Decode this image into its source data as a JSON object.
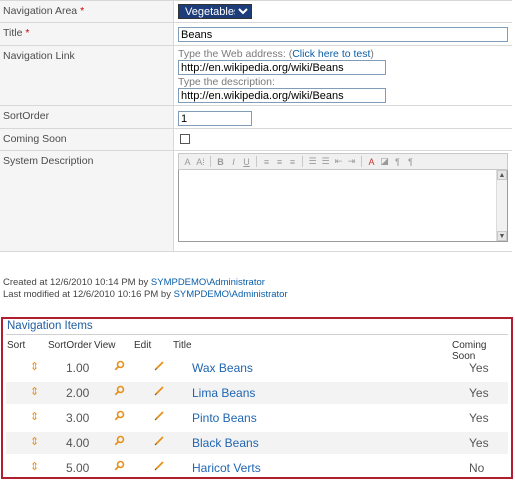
{
  "form": {
    "nav_area": {
      "label": "Navigation Area",
      "required_mark": "*",
      "value": "Vegetables"
    },
    "title": {
      "label": "Title",
      "required_mark": "*",
      "value": "Beans"
    },
    "nav_link": {
      "label": "Navigation Link",
      "web_address_hint": "Type the Web address:",
      "test_link": "Click here to test",
      "url_value": "http://en.wikipedia.org/wiki/Beans",
      "description_hint": "Type the description:",
      "description_value": "http://en.wikipedia.org/wiki/Beans"
    },
    "sort_order": {
      "label": "SortOrder",
      "value": "1"
    },
    "coming_soon": {
      "label": "Coming Soon",
      "checked": false
    },
    "system_description": {
      "label": "System Description"
    }
  },
  "audit": {
    "created_prefix": "Created at 12/6/2010 10:14 PM by",
    "created_by": "SYMPDEMO\\Administrator",
    "modified_prefix": "Last modified at 12/6/2010 10:16 PM by",
    "modified_by": "SYMPDEMO\\Administrator"
  },
  "nav_items": {
    "title": "Navigation Items",
    "headers": {
      "sort": "Sort",
      "sort_order": "SortOrder",
      "view": "View",
      "edit": "Edit",
      "title": "Title",
      "coming_soon": "Coming Soon"
    },
    "rows": [
      {
        "sort_order": "1.00",
        "title": "Wax Beans",
        "coming_soon": "Yes"
      },
      {
        "sort_order": "2.00",
        "title": "Lima Beans",
        "coming_soon": "Yes"
      },
      {
        "sort_order": "3.00",
        "title": "Pinto Beans",
        "coming_soon": "Yes"
      },
      {
        "sort_order": "4.00",
        "title": "Black Beans",
        "coming_soon": "Yes"
      },
      {
        "sort_order": "5.00",
        "title": "Haricot Verts",
        "coming_soon": "No"
      }
    ]
  },
  "colors": {
    "panel_border": "#b11e2e",
    "link": "#2166b2",
    "icon": "#e8901c",
    "required": "#cc0000"
  },
  "icons": {
    "sort": "sort-arrows-icon",
    "view": "magnifier-icon",
    "edit": "pencil-icon"
  }
}
